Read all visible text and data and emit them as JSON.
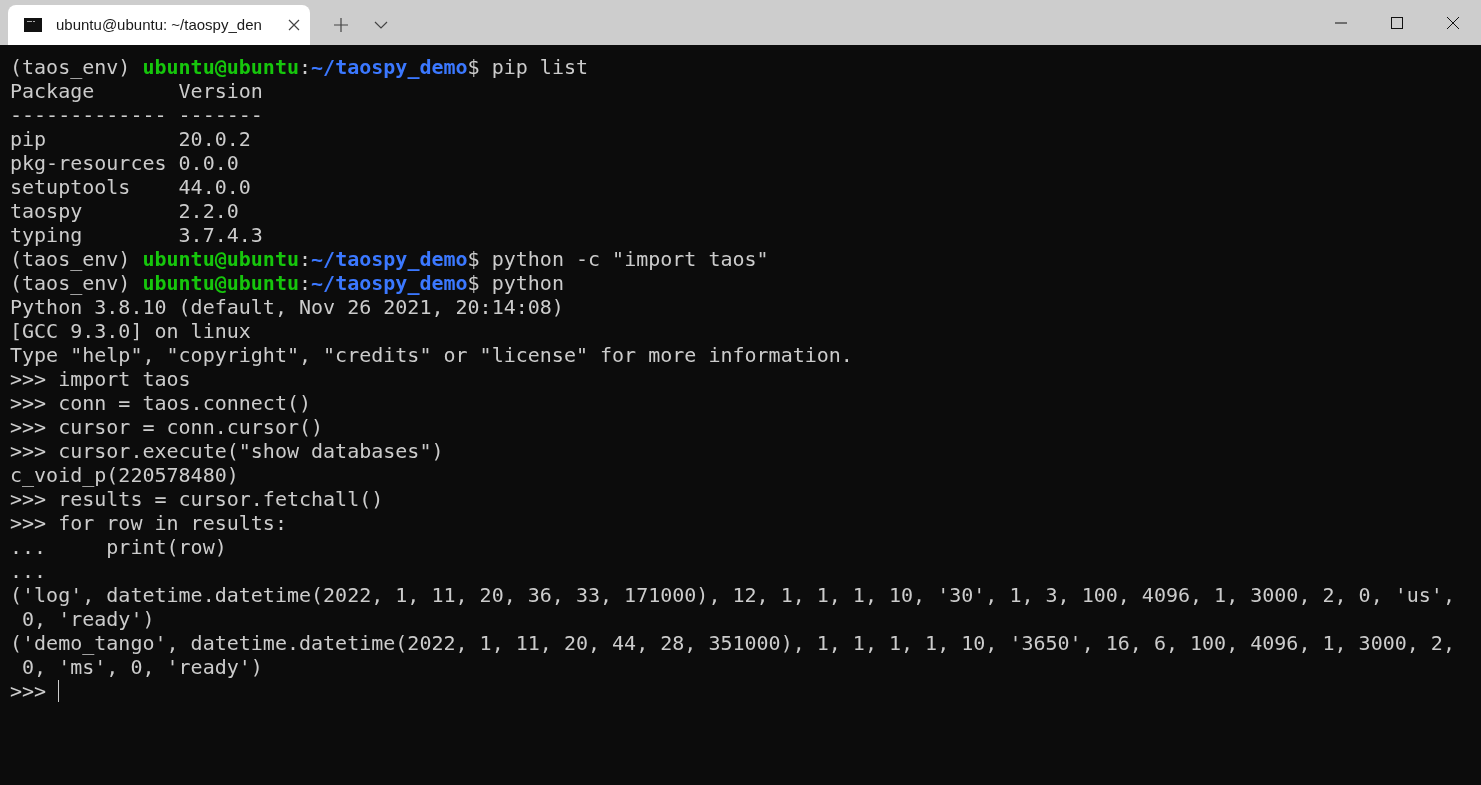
{
  "window": {
    "tabs": [
      {
        "title": "ubuntu@ubuntu: ~/taospy_den",
        "selected": true
      }
    ]
  },
  "terminal": {
    "lines": [
      {
        "kind": "prompt",
        "segments": [
          {
            "kind": "plain",
            "text": "(taos_env) "
          },
          {
            "kind": "user",
            "text": "ubuntu@ubuntu"
          },
          {
            "kind": "plain",
            "text": ":"
          },
          {
            "kind": "path",
            "text": "~/taospy_demo"
          },
          {
            "kind": "plain",
            "text": "$ pip list"
          }
        ]
      },
      {
        "kind": "output",
        "text": "Package       Version"
      },
      {
        "kind": "output",
        "text": "------------- -------"
      },
      {
        "kind": "output",
        "text": "pip           20.0.2"
      },
      {
        "kind": "output",
        "text": "pkg-resources 0.0.0"
      },
      {
        "kind": "output",
        "text": "setuptools    44.0.0"
      },
      {
        "kind": "output",
        "text": "taospy        2.2.0"
      },
      {
        "kind": "output",
        "text": "typing        3.7.4.3"
      },
      {
        "kind": "prompt",
        "segments": [
          {
            "kind": "plain",
            "text": "(taos_env) "
          },
          {
            "kind": "user",
            "text": "ubuntu@ubuntu"
          },
          {
            "kind": "plain",
            "text": ":"
          },
          {
            "kind": "path",
            "text": "~/taospy_demo"
          },
          {
            "kind": "plain",
            "text": "$ python -c \"import taos\""
          }
        ]
      },
      {
        "kind": "prompt",
        "segments": [
          {
            "kind": "plain",
            "text": "(taos_env) "
          },
          {
            "kind": "user",
            "text": "ubuntu@ubuntu"
          },
          {
            "kind": "plain",
            "text": ":"
          },
          {
            "kind": "path",
            "text": "~/taospy_demo"
          },
          {
            "kind": "plain",
            "text": "$ python"
          }
        ]
      },
      {
        "kind": "output",
        "text": "Python 3.8.10 (default, Nov 26 2021, 20:14:08)"
      },
      {
        "kind": "output",
        "text": "[GCC 9.3.0] on linux"
      },
      {
        "kind": "output",
        "text": "Type \"help\", \"copyright\", \"credits\" or \"license\" for more information."
      },
      {
        "kind": "output",
        "text": ">>> import taos"
      },
      {
        "kind": "output",
        "text": ">>> conn = taos.connect()"
      },
      {
        "kind": "output",
        "text": ">>> cursor = conn.cursor()"
      },
      {
        "kind": "output",
        "text": ">>> cursor.execute(\"show databases\")"
      },
      {
        "kind": "output",
        "text": "c_void_p(220578480)"
      },
      {
        "kind": "output",
        "text": ">>> results = cursor.fetchall()"
      },
      {
        "kind": "output",
        "text": ">>> for row in results:"
      },
      {
        "kind": "output",
        "text": "...     print(row)"
      },
      {
        "kind": "output",
        "text": "..."
      },
      {
        "kind": "output",
        "text": "('log', datetime.datetime(2022, 1, 11, 20, 36, 33, 171000), 12, 1, 1, 1, 10, '30', 1, 3, 100, 4096, 1, 3000, 2, 0, 'us',"
      },
      {
        "kind": "output",
        "text": " 0, 'ready')"
      },
      {
        "kind": "output",
        "text": "('demo_tango', datetime.datetime(2022, 1, 11, 20, 44, 28, 351000), 1, 1, 1, 1, 10, '3650', 16, 6, 100, 4096, 1, 3000, 2,"
      },
      {
        "kind": "output",
        "text": " 0, 'ms', 0, 'ready')"
      },
      {
        "kind": "input",
        "text": ">>> "
      }
    ]
  }
}
